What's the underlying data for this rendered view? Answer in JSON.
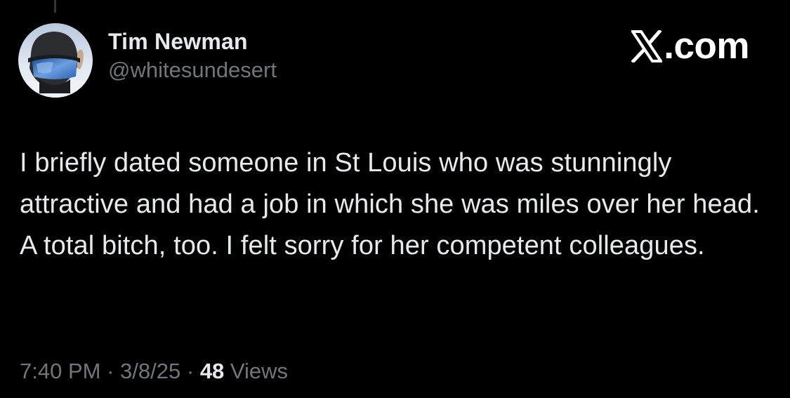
{
  "author": {
    "display_name": "Tim Newman",
    "handle": "@whitesundesert",
    "avatar_icon": "avatar-photo-ski-goggles"
  },
  "brand": {
    "text": ".com",
    "icon": "x-logo-icon",
    "color": "#ffffff"
  },
  "tweet": {
    "text": "I briefly dated someone in St Louis who was stunningly attractive and had a job in which she was miles over her head. A total bitch, too. I felt sorry for her competent colleagues."
  },
  "meta": {
    "time": "7:40 PM",
    "separator": "·",
    "date": "3/8/25",
    "views_count": "48",
    "views_label": "Views"
  },
  "colors": {
    "background": "#000000",
    "primary_text": "#e7e9ea",
    "secondary_text": "#71767b"
  }
}
